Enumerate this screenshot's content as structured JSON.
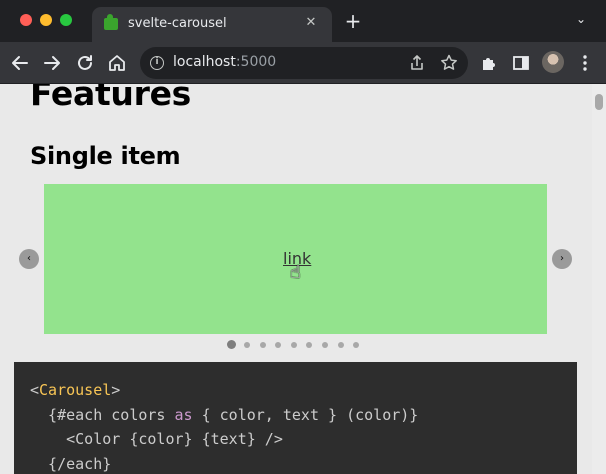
{
  "browser": {
    "tab_title": "svelte-carousel",
    "tab_close": "✕",
    "new_tab": "+",
    "tab_search": "⌄",
    "url_host": "localhost",
    "url_port": ":5000",
    "icons": {
      "back": "back-arrow-icon",
      "forward": "forward-arrow-icon",
      "reload": "reload-icon",
      "home": "home-icon",
      "info": "info-icon",
      "share": "share-icon",
      "bookmark": "star-icon",
      "extensions": "puzzle-icon",
      "sidepanel": "side-panel-icon",
      "menu": "kebab-menu-icon"
    },
    "colors": {
      "traffic_red": "#ff5f57",
      "traffic_yellow": "#febc2e",
      "traffic_green": "#28c840",
      "favicon": "#3aa52d"
    }
  },
  "page": {
    "heading": "Features",
    "subheading": "Single item",
    "carousel": {
      "slide_color": "#93e38d",
      "slide_link": "link",
      "prev_arrow": "‹",
      "next_arrow": "›",
      "dot_count": 9,
      "active_dot": 0
    },
    "code": {
      "line1_open": "<",
      "line1_tag": "Carousel",
      "line1_close": ">",
      "line2_pre": "  {#each colors ",
      "line2_kw": "as",
      "line2_post": " { color, text } (color)}",
      "line3": "    <Color {color} {text} />",
      "line4": "  {/each}"
    }
  }
}
